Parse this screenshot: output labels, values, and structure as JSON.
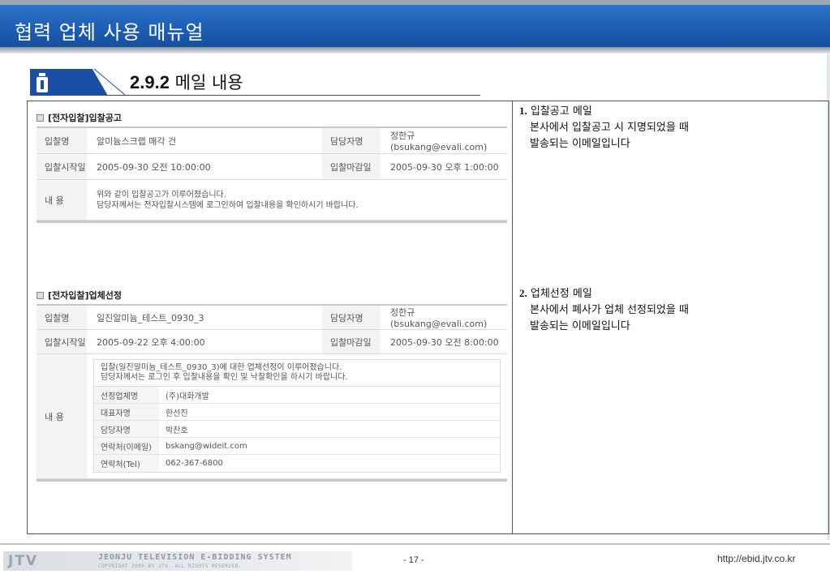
{
  "header": {
    "title": "협력 업체 사용 매뉴얼"
  },
  "section": {
    "number": "2.9.2",
    "title": "메일 내용"
  },
  "mail1": {
    "title": "[전자입찰]입찰공고",
    "rows": [
      {
        "label1": "입찰명",
        "value1": "알미늄스크랩 매각 건",
        "label2": "담당자명",
        "value2": "정한규(bsukang@evali.com)"
      },
      {
        "label1": "입찰시작일",
        "value1": "2005-09-30 오전 10:00:00",
        "label2": "입찰마감일",
        "value2": "2005-09-30 오후 1:00:00"
      }
    ],
    "content_label": "내 용",
    "content_line1": "위와 같이 입찰공고가 이루어졌습니다.",
    "content_line2": "담당자께서는 전자입찰시스템에 로그인하여 입찰내용을 확인하시기 바랍니다."
  },
  "mail2": {
    "title": "[전자입찰]업체선정",
    "rows": [
      {
        "label1": "입찰명",
        "value1": "일진알미늄_테스트_0930_3",
        "label2": "담당자명",
        "value2": "정한규(bsukang@evali.com)"
      },
      {
        "label1": "입찰시작일",
        "value1": "2005-09-22 오후 4:00:00",
        "label2": "입찰마감일",
        "value2": "2005-09-30 오전 8:00:00"
      }
    ],
    "content_label": "내 용",
    "msg_line1": "입찰(일진알미늄_테스트_0930_3)에 대한 업체선정이 이루어졌습니다.",
    "msg_line2": "담당자께서는 로그인 후 입찰내용을 확인 및 낙찰확인을 하시기 바랍니다.",
    "details": [
      {
        "label": "선정업체명",
        "value": "(주)대화개발"
      },
      {
        "label": "대표자명",
        "value": "한선진"
      },
      {
        "label": "담당자명",
        "value": "박찬호"
      },
      {
        "label": "연락처(이메일)",
        "value": "bskang@wideit.com"
      },
      {
        "label": "연락처(Tel)",
        "value": "062-367-6800"
      }
    ]
  },
  "desc1": {
    "num": "1.",
    "title": "입찰공고 메일",
    "line1": "본사에서 입찰공고 시 지명되었을 때",
    "line2": "발송되는 이메일입니다"
  },
  "desc2": {
    "num": "2.",
    "title": "업체선정 메일",
    "line1": "본사에서 폐사가 업체 선정되었을 때",
    "line2": "발송되는 이메일입니다"
  },
  "footer": {
    "logo": "JTV",
    "system": "JEONJU TELEVISION E-BIDDING SYSTEM",
    "copyright": "COPYRIGHT 2005 BY JTV. ALL RIGHTS RESERVED.",
    "page": "- 17 -",
    "url": "http://ebid.jtv.co.kr"
  }
}
